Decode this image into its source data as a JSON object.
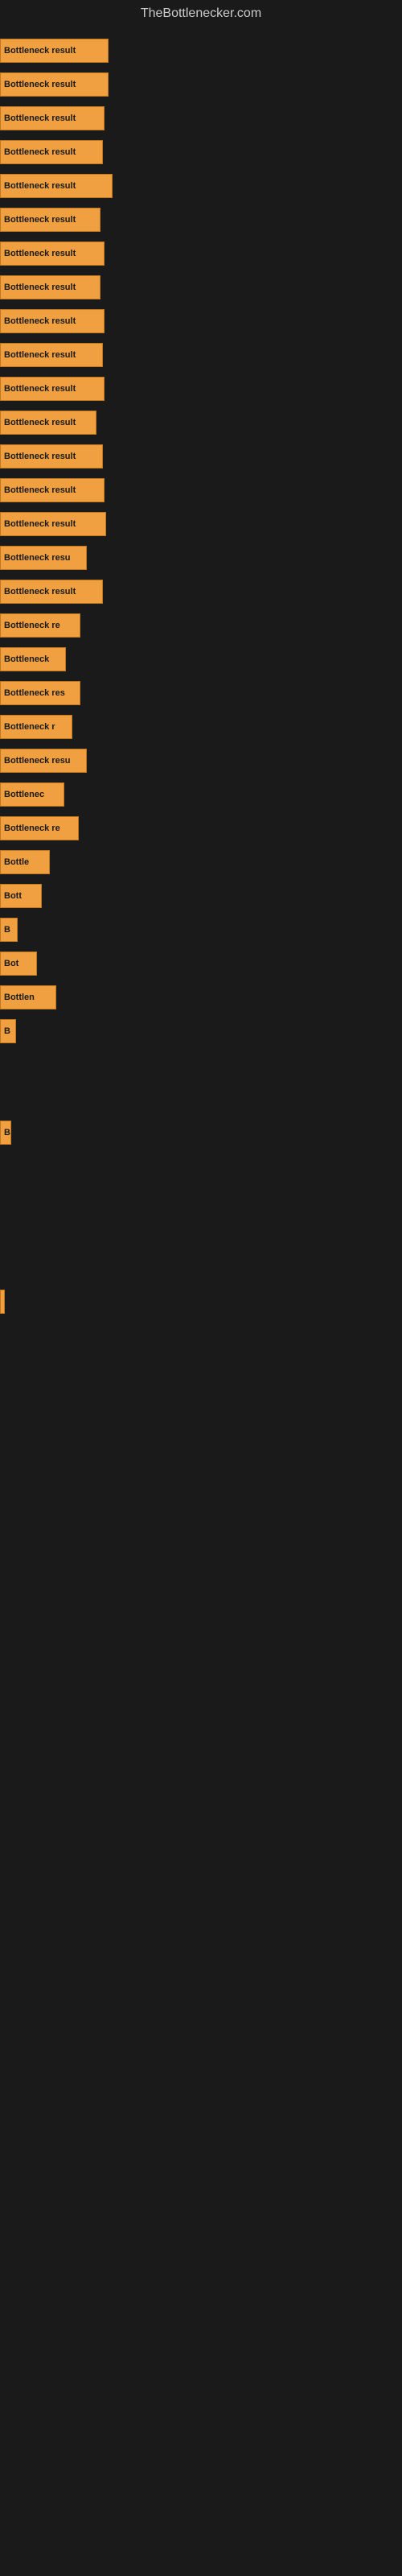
{
  "site_title": "TheBottlenecker.com",
  "bars": [
    {
      "label": "Bottleneck result",
      "width": 135,
      "visible_text": "Bottleneck result"
    },
    {
      "label": "Bottleneck result",
      "width": 135,
      "visible_text": "Bottleneck result"
    },
    {
      "label": "Bottleneck result",
      "width": 130,
      "visible_text": "Bottleneck result"
    },
    {
      "label": "Bottleneck result",
      "width": 128,
      "visible_text": "Bottleneck result"
    },
    {
      "label": "Bottleneck result",
      "width": 140,
      "visible_text": "Bottleneck result"
    },
    {
      "label": "Bottleneck result",
      "width": 125,
      "visible_text": "Bottleneck result"
    },
    {
      "label": "Bottleneck result",
      "width": 130,
      "visible_text": "Bottleneck result"
    },
    {
      "label": "Bottleneck result",
      "width": 125,
      "visible_text": "Bottleneck result"
    },
    {
      "label": "Bottleneck result",
      "width": 130,
      "visible_text": "Bottleneck result"
    },
    {
      "label": "Bottleneck result",
      "width": 128,
      "visible_text": "Bottleneck result"
    },
    {
      "label": "Bottleneck result",
      "width": 130,
      "visible_text": "Bottleneck result"
    },
    {
      "label": "Bottleneck result",
      "width": 120,
      "visible_text": "Bottleneck result"
    },
    {
      "label": "Bottleneck result",
      "width": 128,
      "visible_text": "Bottleneck result"
    },
    {
      "label": "Bottleneck result",
      "width": 130,
      "visible_text": "Bottleneck result"
    },
    {
      "label": "Bottleneck result",
      "width": 132,
      "visible_text": "Bottleneck result"
    },
    {
      "label": "Bottleneck result",
      "width": 108,
      "visible_text": "Bottleneck resu"
    },
    {
      "label": "Bottleneck result",
      "width": 128,
      "visible_text": "Bottleneck result"
    },
    {
      "label": "Bottleneck result",
      "width": 100,
      "visible_text": "Bottleneck re"
    },
    {
      "label": "Bottleneck",
      "width": 82,
      "visible_text": "Bottleneck"
    },
    {
      "label": "Bottleneck result",
      "width": 100,
      "visible_text": "Bottleneck res"
    },
    {
      "label": "Bottleneck result",
      "width": 90,
      "visible_text": "Bottleneck r"
    },
    {
      "label": "Bottleneck result",
      "width": 108,
      "visible_text": "Bottleneck resu"
    },
    {
      "label": "Bottleneck",
      "width": 80,
      "visible_text": "Bottlenec"
    },
    {
      "label": "Bottleneck result",
      "width": 98,
      "visible_text": "Bottleneck re"
    },
    {
      "label": "Bottleneck",
      "width": 62,
      "visible_text": "Bottle"
    },
    {
      "label": "Bottleneck",
      "width": 52,
      "visible_text": "Bott"
    },
    {
      "label": "Bottleneck",
      "width": 22,
      "visible_text": "B"
    },
    {
      "label": "Bottleneck",
      "width": 46,
      "visible_text": "Bot"
    },
    {
      "label": "Bottleneck",
      "width": 70,
      "visible_text": "Bottlen"
    },
    {
      "label": "Bottleneck",
      "width": 20,
      "visible_text": "B"
    },
    {
      "label": "",
      "width": 0,
      "visible_text": ""
    },
    {
      "label": "",
      "width": 0,
      "visible_text": ""
    },
    {
      "label": "Bottleneck",
      "width": 14,
      "visible_text": "B"
    },
    {
      "label": "",
      "width": 0,
      "visible_text": ""
    },
    {
      "label": "",
      "width": 0,
      "visible_text": ""
    },
    {
      "label": "",
      "width": 0,
      "visible_text": ""
    },
    {
      "label": "",
      "width": 0,
      "visible_text": ""
    },
    {
      "label": "",
      "width": 6,
      "visible_text": ""
    }
  ]
}
